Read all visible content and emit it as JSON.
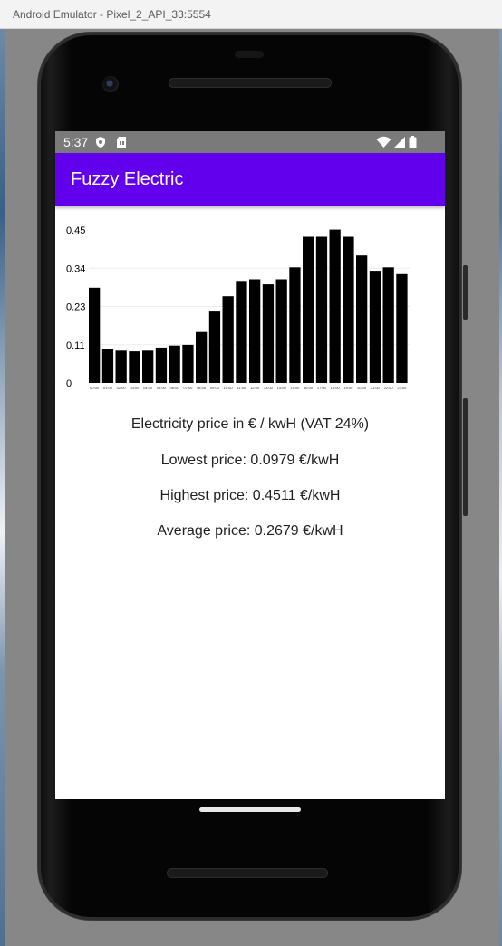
{
  "window": {
    "title": "Android Emulator - Pixel_2_API_33:5554"
  },
  "status_bar": {
    "time": "5:37",
    "icons": [
      "shield-icon",
      "sim-card-icon",
      "wifi-icon",
      "signal-icon",
      "battery-icon"
    ]
  },
  "app_bar": {
    "title": "Fuzzy Electric",
    "color": "#6200ee"
  },
  "chart_data": {
    "type": "bar",
    "categories": [
      "00:00",
      "01:00",
      "02:00",
      "03:00",
      "04:00",
      "05:00",
      "06:00",
      "07:00",
      "08:00",
      "09:00",
      "10:00",
      "11:00",
      "12:00",
      "13:00",
      "14:00",
      "15:00",
      "16:00",
      "17:00",
      "18:00",
      "19:00",
      "20:00",
      "21:00",
      "22:00",
      "23:00"
    ],
    "values": [
      0.28,
      0.1,
      0.095,
      0.093,
      0.095,
      0.104,
      0.11,
      0.112,
      0.15,
      0.21,
      0.255,
      0.3,
      0.305,
      0.29,
      0.305,
      0.34,
      0.43,
      0.43,
      0.4511,
      0.43,
      0.375,
      0.33,
      0.34,
      0.32
    ],
    "yticks": [
      "0.45",
      "0.34",
      "0.23",
      "0.11",
      "0"
    ],
    "ylim": [
      0,
      0.45
    ],
    "bar_color": "#000000"
  },
  "info": {
    "caption": "Electricity price in € / kwH (VAT 24%)",
    "lowest": "Lowest price: 0.0979 €/kwH",
    "highest": "Highest price: 0.4511 €/kwH",
    "average": "Average price: 0.2679 €/kwH"
  }
}
